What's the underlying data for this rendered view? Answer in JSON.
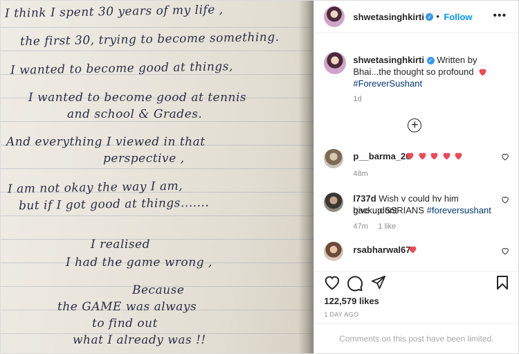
{
  "post": {
    "image": {
      "handwriting": [
        "I think I spent 30 years of my life ,",
        "the first 30, trying to become something.",
        "I wanted to become good at things,",
        "I wanted to become good at tennis",
        "and school & Grades.",
        "And everything I viewed in that",
        "perspective ,",
        "I am not okay the way I am,",
        "but if I got good at things.......",
        "I realised",
        "I had the game wrong ,",
        "Because",
        "the GAME was always",
        "to find out",
        "what I already was !!"
      ]
    },
    "header": {
      "username": "shwetasinghkirti",
      "verified_mark": "✓",
      "separator": "•",
      "follow_label": "Follow",
      "more_label": "•••"
    },
    "caption": {
      "username": "shwetasinghkirti",
      "verified_mark": "✓",
      "text_line1": "Written by",
      "text_line2": "Bhai...the thought so profound",
      "hashtag": "#ForeverSushant",
      "time": "1d"
    },
    "load_more_label": "+",
    "comments": [
      {
        "username": "p__barma_20",
        "text": "",
        "hearts": 5,
        "time": "48m",
        "likes": ""
      },
      {
        "username": "l737d",
        "text": "Wish v could hv him back...dont",
        "text2": "give up SSRIANS",
        "hashtag": "#foreversushant",
        "time": "47m",
        "likes": "1 like"
      },
      {
        "username": "rsabharwal67",
        "text": "",
        "hearts": 1,
        "time": "",
        "likes": ""
      }
    ],
    "likes_count": "122,579 likes",
    "posted_ago": "1 DAY AGO",
    "comments_limited": "Comments on this post have been limited.",
    "colors": {
      "heart": "#ed4956",
      "link": "#0095f6",
      "hashtag": "#00376b"
    }
  }
}
